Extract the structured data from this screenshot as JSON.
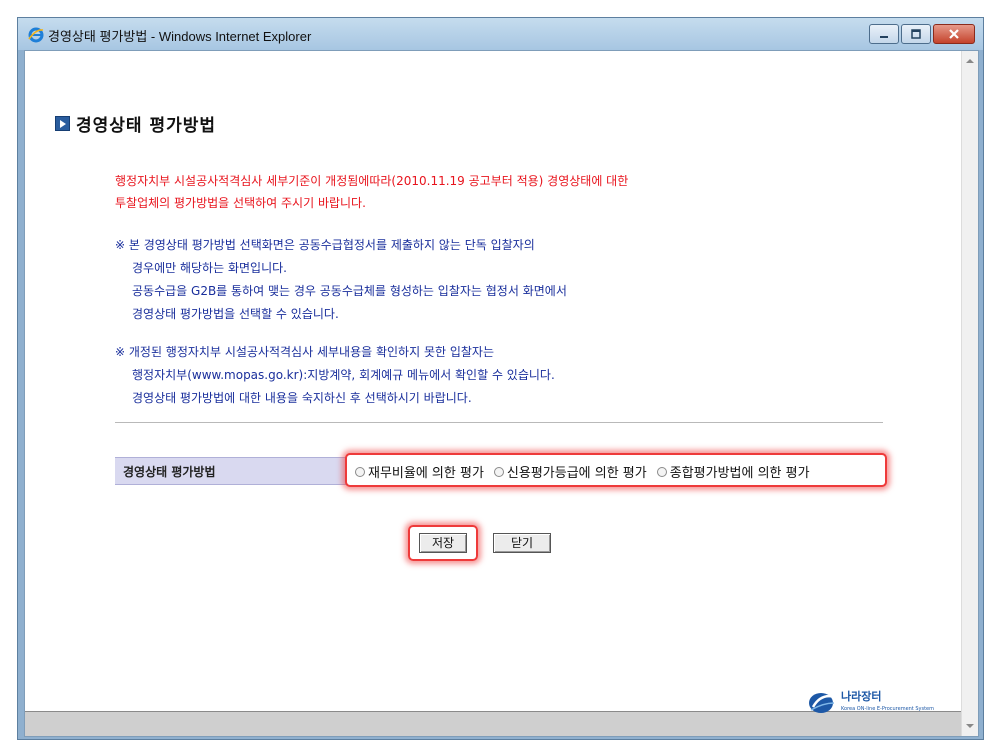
{
  "window": {
    "title": "경영상태 평가방법 - Windows Internet Explorer"
  },
  "page": {
    "title": "경영상태 평가방법",
    "notice_red": [
      "행정자치부 시설공사적격심사 세부기준이 개정됨에따라(2010.11.19 공고부터 적용) 경영상태에 대한",
      "투찰업체의 평가방법을 선택하여 주시기 바랍니다."
    ],
    "notice_blue_1": [
      "※ 본 경영상태 평가방법 선택화면은 공동수급협정서를 제출하지 않는 단독 입찰자의",
      "경우에만 해당하는 화면입니다.",
      "공동수급을 G2B를 통하여 맺는 경우 공동수급체를 형성하는 입찰자는 협정서 화면에서",
      "경영상태 평가방법을 선택할 수 있습니다."
    ],
    "notice_blue_2": [
      "※ 개정된 행정자치부 시설공사적격심사 세부내용을 확인하지 못한 입찰자는",
      "행정자치부(www.mopas.go.kr):지방계약, 회계예규 메뉴에서 확인할 수 있습니다.",
      "경영상태 평가방법에 대한 내용을 숙지하신 후 선택하시기 바랍니다."
    ],
    "method_label": "경영상태 평가방법",
    "options": [
      "재무비율에 의한 평가",
      "신용평가등급에 의한 평가",
      "종합평가방법에 의한 평가"
    ],
    "save_button": "저장",
    "close_button": "닫기",
    "logo": {
      "main": "나라장터",
      "sub": "Korea ON-line E-Procurement System"
    }
  },
  "colors": {
    "notice_red": "#e8141d",
    "notice_blue": "#1a2f9c",
    "highlight": "#ee3a3a",
    "label_row": "#d9d9f0"
  }
}
